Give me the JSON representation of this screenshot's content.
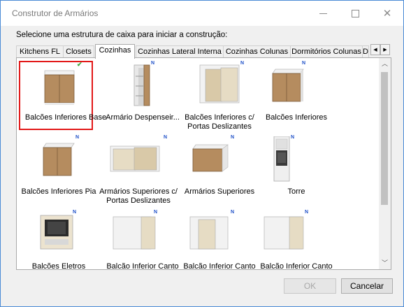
{
  "window": {
    "title": "Construtor de Armários",
    "instruction": "Selecione uma estrutura de caixa para iniciar a construção:"
  },
  "tabs": [
    {
      "label": "Kitchens FL"
    },
    {
      "label": "Closets"
    },
    {
      "label": "Cozinhas",
      "active": true
    },
    {
      "label": "Cozinhas Lateral Interna"
    },
    {
      "label": "Cozinhas Colunas"
    },
    {
      "label": "Dormitórios Colunas"
    },
    {
      "label": "D"
    }
  ],
  "items": [
    {
      "label": "Balcões Inferiores Base",
      "badge": "check-icon",
      "selected": true
    },
    {
      "label": "Armário Despenseir...",
      "badge": "N"
    },
    {
      "label": "Balcões Inferiores c/ Portas Deslizantes",
      "badge": "N"
    },
    {
      "label": "Balcões Inferiores",
      "badge": "N"
    },
    {
      "label": "Balcões Inferiores Pia",
      "badge": "N"
    },
    {
      "label": "Armários Superiores c/ Portas Deslizantes",
      "badge": "N"
    },
    {
      "label": "Armários Superiores",
      "badge": "N"
    },
    {
      "label": "Torre",
      "badge": "N"
    },
    {
      "label": "Balcões Eletros",
      "badge": "N"
    },
    {
      "label": "Balcão Inferior Canto Reto Esq.",
      "badge": "N"
    },
    {
      "label": "Balcão Inferior Canto Reto Dir.",
      "badge": "N"
    },
    {
      "label": "Balcão Inferior Canto Reto Esq.",
      "badge": "N"
    }
  ],
  "buttons": {
    "ok": "OK",
    "cancel": "Cancelar"
  },
  "colors": {
    "selection": "#e21818",
    "badge": "#1f50c8",
    "wood": "#b58c5f"
  }
}
